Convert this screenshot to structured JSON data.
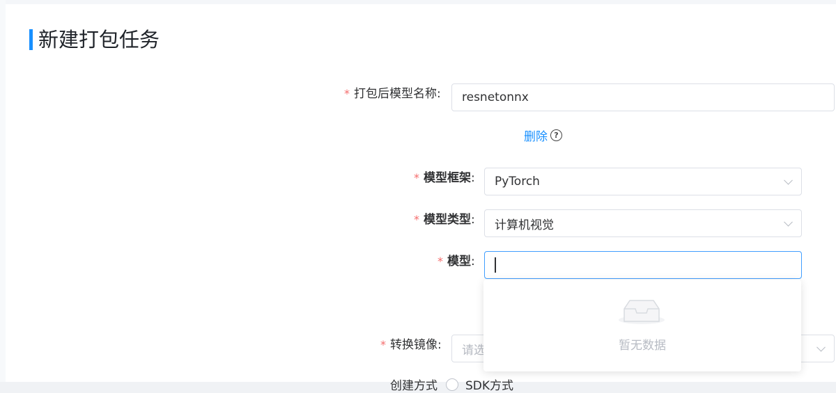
{
  "page": {
    "title": "新建打包任务",
    "accent": "#1890ff"
  },
  "form": {
    "package_name": {
      "label": "打包后模型名称",
      "value": "resnetonnx"
    },
    "delete": {
      "label": "删除",
      "icon": "help-circle-icon"
    },
    "framework": {
      "label": "模型框架",
      "value": "PyTorch",
      "icon": "chevron-down-icon"
    },
    "model_type": {
      "label": "模型类型",
      "value": "计算机视觉",
      "icon": "chevron-down-icon"
    },
    "model": {
      "label": "模型",
      "value": ""
    },
    "model_dropdown": {
      "empty_text": "暂无数据",
      "icon": "empty-inbox-icon"
    },
    "image": {
      "label": "转换镜像",
      "placeholder": "请选",
      "icon": "chevron-down-icon"
    },
    "mode": {
      "label": "创建方式",
      "option": "SDK方式"
    }
  },
  "colors": {
    "required": "#f56c6c",
    "focus_border": "#409eff",
    "border": "#dcdfe6"
  }
}
